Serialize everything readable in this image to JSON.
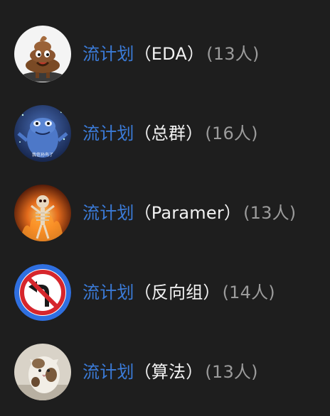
{
  "groups": [
    {
      "prefix": "流计划",
      "name": "（EDA）",
      "count": "(13人)",
      "avatar_icon": "poop-emoji-avatar-icon"
    },
    {
      "prefix": "流计划",
      "name": "（总群）",
      "count": "(16人)",
      "avatar_icon": "blue-creature-avatar-icon"
    },
    {
      "prefix": "流计划",
      "name": "（Paramer）",
      "count": "(13人)",
      "avatar_icon": "fire-skeleton-avatar-icon"
    },
    {
      "prefix": "流计划",
      "name": "（反向组）",
      "count": "(14人)",
      "avatar_icon": "no-left-turn-sign-avatar-icon"
    },
    {
      "prefix": "流计划",
      "name": "（算法）",
      "count": "(13人)",
      "avatar_icon": "cat-photo-avatar-icon"
    }
  ],
  "colors": {
    "background": "#1e1e1e",
    "prefix": "#3b7bd8",
    "name": "#f2f2f2",
    "count": "#9b9b9b"
  }
}
